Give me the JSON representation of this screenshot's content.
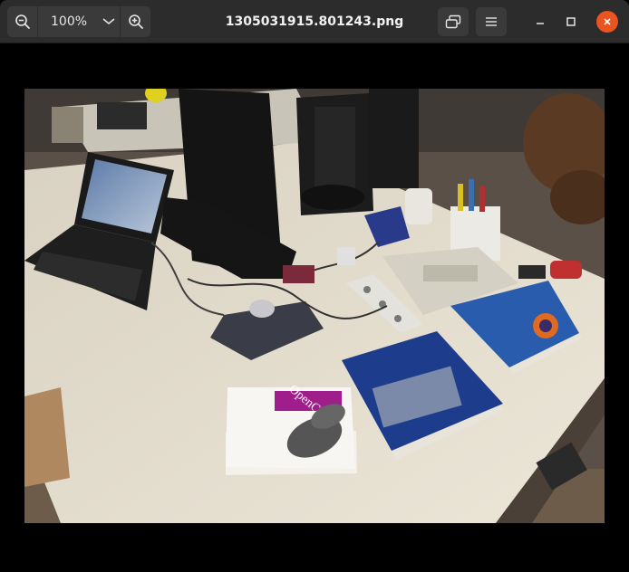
{
  "window": {
    "title": "1305031915.801243.png"
  },
  "toolbar": {
    "zoom_level": "100%",
    "zoom_out_icon": "zoom-out-icon",
    "zoom_in_icon": "zoom-in-icon",
    "zoom_menu_icon": "chevron-down-icon",
    "slideshow_icon": "slideshow-icon",
    "menu_icon": "hamburger-menu-icon"
  },
  "window_controls": {
    "minimize_icon": "minimize-icon",
    "maximize_icon": "maximize-icon",
    "close_icon": "close-icon",
    "close_color": "#e95420"
  },
  "photo": {
    "book_label": "OpenCV"
  }
}
